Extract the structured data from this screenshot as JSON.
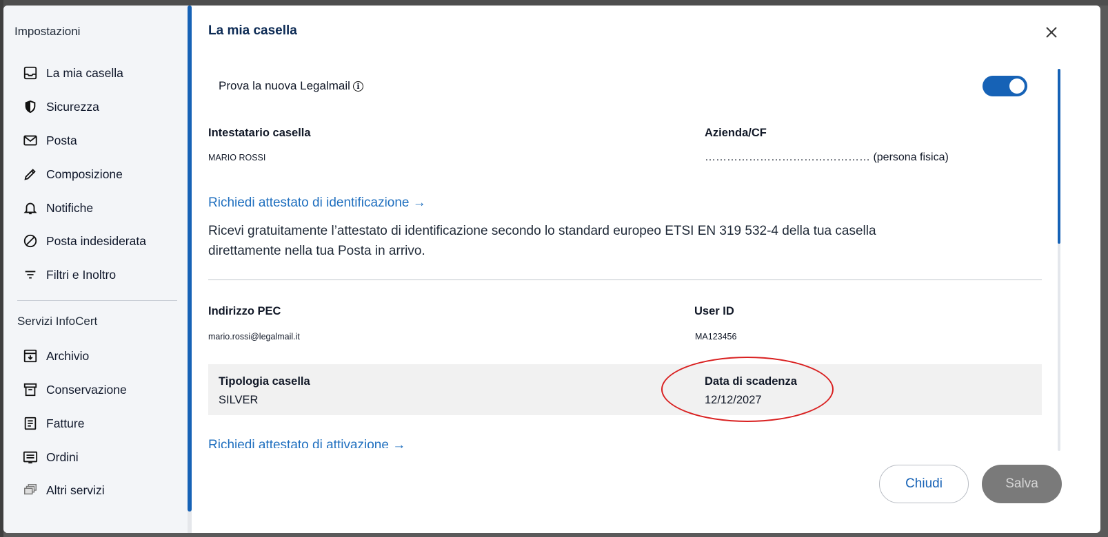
{
  "sidebar": {
    "heading": "Impostazioni",
    "items": [
      {
        "label": "La mia casella",
        "icon": "inbox-icon"
      },
      {
        "label": "Sicurezza",
        "icon": "shield-icon"
      },
      {
        "label": "Posta",
        "icon": "envelope-icon"
      },
      {
        "label": "Composizione",
        "icon": "pencil-icon"
      },
      {
        "label": "Notifiche",
        "icon": "bell-icon"
      },
      {
        "label": "Posta indesiderata",
        "icon": "block-icon"
      },
      {
        "label": "Filtri e Inoltro",
        "icon": "filter-icon"
      }
    ],
    "services_heading": "Servizi InfoCert",
    "services": [
      {
        "label": "Archivio",
        "icon": "archive-download-icon"
      },
      {
        "label": "Conservazione",
        "icon": "archive-box-icon"
      },
      {
        "label": "Fatture",
        "icon": "invoice-icon"
      },
      {
        "label": "Ordini",
        "icon": "orders-icon"
      },
      {
        "label": "Altri servizi",
        "icon": "stack-icon"
      }
    ]
  },
  "main": {
    "title": "La mia casella",
    "toggle": {
      "label": "Prova la nuova Legalmail",
      "enabled": true
    },
    "owner": {
      "label": "Intestatario casella",
      "value": "MARIO ROSSI"
    },
    "company": {
      "label": "Azienda/CF",
      "value": "……………………………………… (persona fisica)"
    },
    "attestato_id": {
      "link": "Richiedi attestato di identificazione →",
      "description": "Ricevi gratuitamente l’attestato di identificazione secondo lo standard europeo ETSI EN 319 532-4 della tua casella direttamente nella tua Posta in arrivo."
    },
    "pec": {
      "label": "Indirizzo PEC",
      "value": "mario.rossi@legalmail.it"
    },
    "user_id": {
      "label": "User ID",
      "value": "MA123456"
    },
    "type": {
      "label": "Tipologia casella",
      "value": "SILVER"
    },
    "expiry": {
      "label": "Data di scadenza",
      "value": "12/12/2027"
    },
    "attestato_att": {
      "link": "Richiedi attestato di attivazione →"
    }
  },
  "footer": {
    "close_label": "Chiudi",
    "save_label": "Salva"
  },
  "colors": {
    "accent": "#1662b6",
    "link": "#1f6fbf",
    "highlight_circle": "#d92020"
  }
}
